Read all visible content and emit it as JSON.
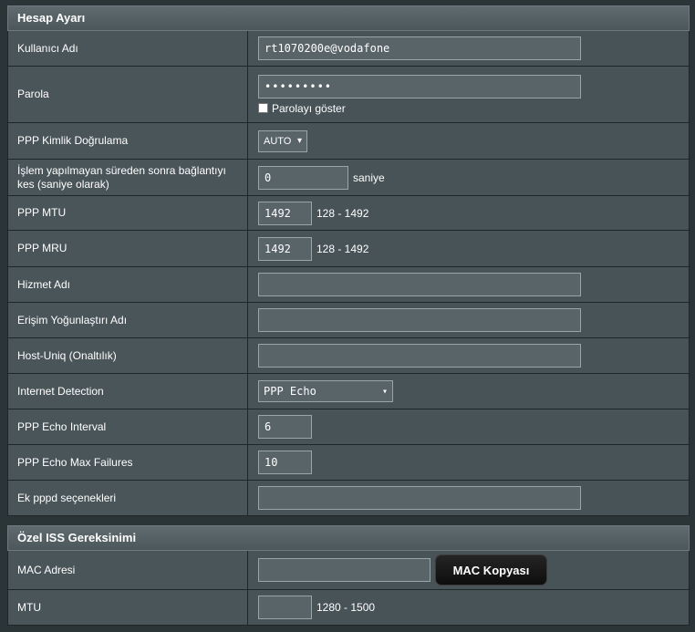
{
  "account": {
    "title": "Hesap Ayarı",
    "username": {
      "label": "Kullanıcı Adı",
      "value": "rt1070200e@vodafone"
    },
    "password": {
      "label": "Parola",
      "masked": "•••••••••",
      "show_label": "Parolayı göster"
    },
    "auth": {
      "label": "PPP Kimlik Doğrulama",
      "selected": "AUTO"
    },
    "idle": {
      "label": "İşlem yapılmayan süreden sonra bağlantıyı kes (saniye olarak)",
      "value": "0",
      "unit": "saniye"
    },
    "mtu": {
      "label": "PPP MTU",
      "value": "1492",
      "range": "128 - 1492"
    },
    "mru": {
      "label": "PPP MRU",
      "value": "1492",
      "range": "128 - 1492"
    },
    "service": {
      "label": "Hizmet Adı",
      "value": ""
    },
    "concentrator": {
      "label": "Erişim Yoğunlaştırı Adı",
      "value": ""
    },
    "host_uniq": {
      "label": "Host-Uniq (Onaltılık)",
      "value": ""
    },
    "detection": {
      "label": "Internet Detection",
      "selected": "PPP Echo"
    },
    "echo_interval": {
      "label": "PPP Echo Interval",
      "value": "6"
    },
    "echo_failures": {
      "label": "PPP Echo Max Failures",
      "value": "10"
    },
    "pppd_options": {
      "label": "Ek pppd seçenekleri",
      "value": ""
    }
  },
  "isp": {
    "title": "Özel ISS Gereksinimi",
    "mac": {
      "label": "MAC Adresi",
      "value": "",
      "button_label": "MAC Kopyası"
    },
    "mtu": {
      "label": "MTU",
      "value": "",
      "range": "1280 - 1500"
    }
  }
}
